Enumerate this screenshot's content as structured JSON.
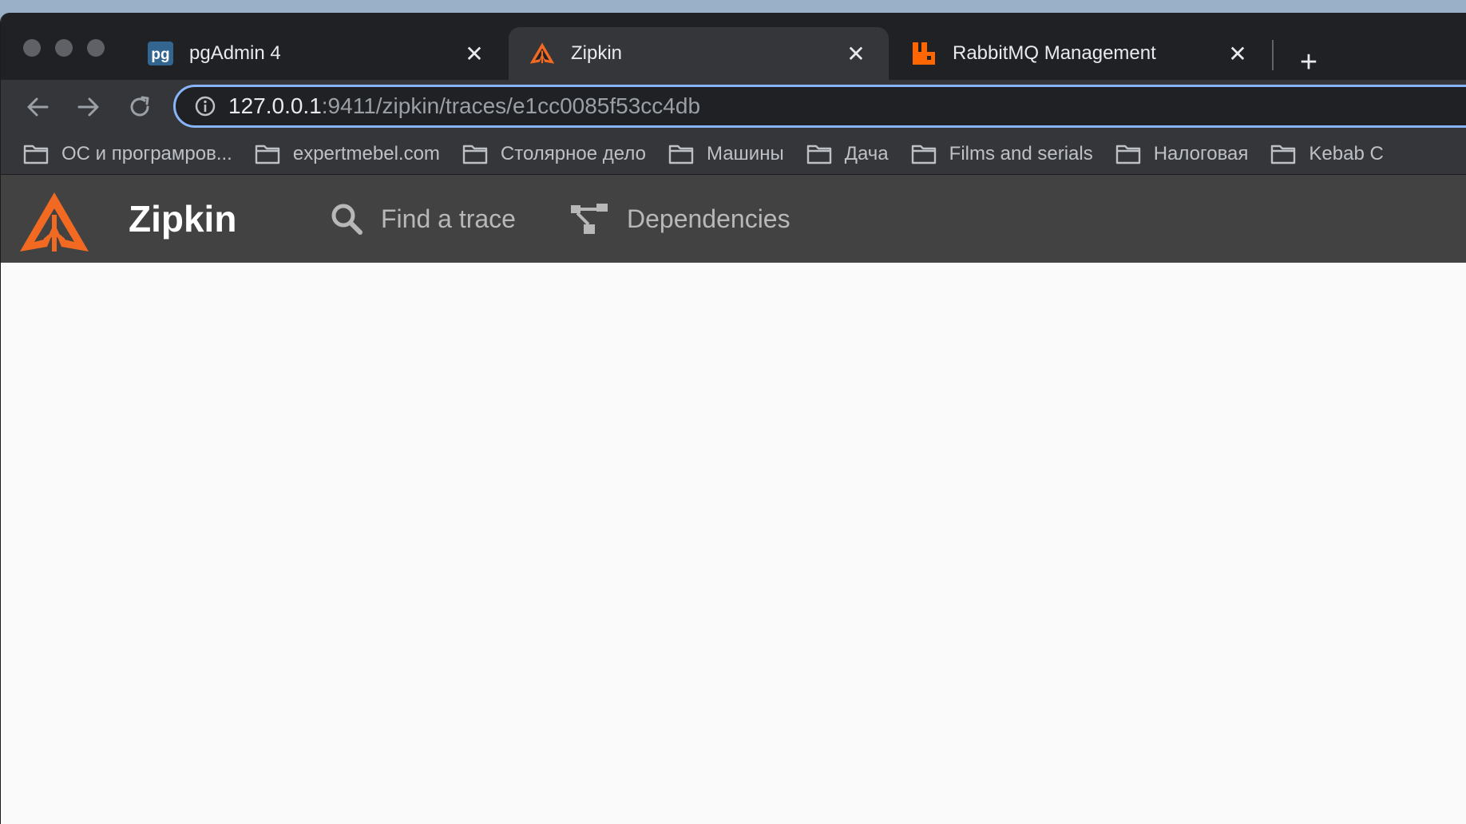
{
  "browser": {
    "tabs": [
      {
        "title": "pgAdmin 4",
        "icon": "pgadmin-icon",
        "active": false
      },
      {
        "title": "Zipkin",
        "icon": "zipkin-icon",
        "active": true
      },
      {
        "title": "RabbitMQ Management",
        "icon": "rabbitmq-icon",
        "active": false
      }
    ],
    "close_glyph": "✕",
    "new_tab_glyph": "+",
    "address": {
      "host": "127.0.0.1",
      "path": ":9411/zipkin/traces/e1cc0085f53cc4db"
    },
    "bookmarks": [
      {
        "label": "ОС и програмров..."
      },
      {
        "label": "expertmebel.com"
      },
      {
        "label": "Столярное дело"
      },
      {
        "label": "Машины"
      },
      {
        "label": "Дача"
      },
      {
        "label": "Films and serials"
      },
      {
        "label": "Налоговая"
      },
      {
        "label": "Kebab C"
      }
    ]
  },
  "app": {
    "brand": "Zipkin",
    "nav": {
      "find_trace": "Find a trace",
      "dependencies": "Dependencies"
    }
  },
  "colors": {
    "zipkin_orange": "#f26a21",
    "appbar": "#424242",
    "omnibox_focus": "#8ab4f8"
  }
}
